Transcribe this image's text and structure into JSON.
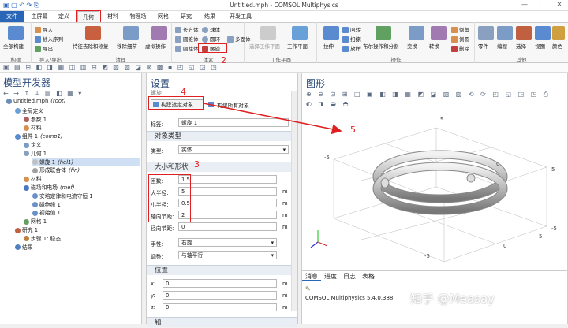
{
  "window": {
    "title": "Untitled.mph - COMSOL Multiphysics"
  },
  "menu": {
    "file": "文件",
    "tabs": [
      "主屏幕",
      "定义",
      "几何",
      "材料",
      "物理场",
      "网格",
      "研究",
      "结果",
      "开发工具"
    ]
  },
  "ribbon": {
    "build_all": "全部构建",
    "group_build": "构建",
    "import": "导入",
    "insert_sequence": "插入序列",
    "export": "导出",
    "group_import_export": "导入/导出",
    "feature_removal": "特征去除和修复",
    "remove_details": "移除细节",
    "virtual_ops": "虚拟操作",
    "group_cleanup": "清理",
    "block": "长方体",
    "sphere": "球体",
    "cylinder": "圆柱体",
    "cone": "圆锥体",
    "torus": "圆环",
    "helix": "螺旋",
    "polyhedron": "多面体",
    "group_primitives": "体素",
    "select_workplane": "选择工作平面",
    "workplane": "工作平面",
    "group_workplane": "工作平面",
    "extrude": "拉伸",
    "revolve": "回转",
    "sweep": "扫掠",
    "loft": "放样",
    "booleans": "布尔操作和分割",
    "transforms": "变换",
    "convert": "转换",
    "group_operations": "操作",
    "chamfer": "倒角",
    "fillet": "倒圆",
    "delete": "删除",
    "parts": "零件",
    "programming": "编程",
    "selections": "选择",
    "views": "视图",
    "colors": "颜色",
    "group_other": "其他"
  },
  "model_builder": {
    "title": "模型开发器",
    "tree": [
      {
        "label": "Untitled.mph",
        "tag": "(root)",
        "level": 0,
        "icon": "mph-icon",
        "icon_color": "#6b8bb8"
      },
      {
        "label": "全局定义",
        "tag": "",
        "level": 1,
        "icon": "globe-icon",
        "icon_color": "#6aa0d8"
      },
      {
        "label": "参数 1",
        "tag": "",
        "level": 2,
        "icon": "pi-icon",
        "icon_color": "#b06060"
      },
      {
        "label": "材料",
        "tag": "",
        "level": 2,
        "icon": "material-icon",
        "icon_color": "#d89050"
      },
      {
        "label": "组件 1",
        "tag": "(comp1)",
        "level": 1,
        "icon": "component-icon",
        "icon_color": "#5a8ad0"
      },
      {
        "label": "定义",
        "tag": "",
        "level": 2,
        "icon": "definitions-icon",
        "icon_color": "#7a9cc6"
      },
      {
        "label": "几何 1",
        "tag": "",
        "level": 2,
        "icon": "geometry-icon",
        "icon_color": "#8aa0c0"
      },
      {
        "label": "螺旋 1",
        "tag": "(hel1)",
        "level": 3,
        "icon": "helix-icon",
        "icon_color": "#c0c0c0"
      },
      {
        "label": "形成联合体",
        "tag": "(fin)",
        "level": 3,
        "icon": "union-icon",
        "icon_color": "#a0a0a0"
      },
      {
        "label": "材料",
        "tag": "",
        "level": 2,
        "icon": "material-icon",
        "icon_color": "#d89050"
      },
      {
        "label": "磁场和电场",
        "tag": "(mef)",
        "level": 2,
        "icon": "physics-icon",
        "icon_color": "#4a78c0"
      },
      {
        "label": "安培定律和电流守恒 1",
        "tag": "",
        "level": 3,
        "icon": "law-icon",
        "icon_color": "#6a90c8"
      },
      {
        "label": "磁绝缘 1",
        "tag": "",
        "level": 3,
        "icon": "boundary-icon",
        "icon_color": "#6a90c8"
      },
      {
        "label": "初始值 1",
        "tag": "",
        "level": 3,
        "icon": "initial-icon",
        "icon_color": "#6a90c8"
      },
      {
        "label": "网格 1",
        "tag": "",
        "level": 2,
        "icon": "mesh-icon",
        "icon_color": "#60a060"
      },
      {
        "label": "研究 1",
        "tag": "",
        "level": 1,
        "icon": "study-icon",
        "icon_color": "#c06040"
      },
      {
        "label": "步骤 1: 稳态",
        "tag": "",
        "level": 2,
        "icon": "step-icon",
        "icon_color": "#c08040"
      },
      {
        "label": "结果",
        "tag": "",
        "level": 1,
        "icon": "results-icon",
        "icon_color": "#5080c0"
      }
    ]
  },
  "settings": {
    "title": "设置",
    "subtitle": "螺旋",
    "build_selected": "构建选定对象",
    "build_all": "构建所有对象",
    "label_label": "标签:",
    "label_value": "螺旋 1",
    "obj_type_section": "对象类型",
    "type_label": "类型:",
    "type_value": "实体",
    "size_section": "大小和形状",
    "fields": [
      {
        "label": "匝数:",
        "value": "1.5",
        "unit": ""
      },
      {
        "label": "大半径:",
        "value": "5",
        "unit": "m"
      },
      {
        "label": "小半径:",
        "value": "0.5",
        "unit": "m"
      },
      {
        "label": "轴向节距:",
        "value": "2",
        "unit": "m"
      },
      {
        "label": "径向节距:",
        "value": "0",
        "unit": "m"
      }
    ],
    "handedness_label": "手性:",
    "handedness_value": "右旋",
    "twist_label": "调整:",
    "twist_value": "与轴平行",
    "position_section": "位置",
    "pos": [
      {
        "label": "x:",
        "value": "0",
        "unit": "m"
      },
      {
        "label": "y:",
        "value": "0",
        "unit": "m"
      },
      {
        "label": "z:",
        "value": "0",
        "unit": "m"
      }
    ],
    "axis_section": "轴"
  },
  "graphics": {
    "title": "图形"
  },
  "messages": {
    "tabs": [
      "消息",
      "进度",
      "日志",
      "表格"
    ],
    "text": "COMSOL Multiphysics 5.4.0.388"
  },
  "annotations": {
    "n1": "1",
    "n2": "2",
    "n3": "3",
    "n4": "4",
    "n5": "5"
  },
  "watermark": "知乎 @Measay",
  "axis_ticks": [
    "5",
    "-5",
    "5",
    "0",
    "-5",
    "-5",
    "0",
    "5"
  ]
}
